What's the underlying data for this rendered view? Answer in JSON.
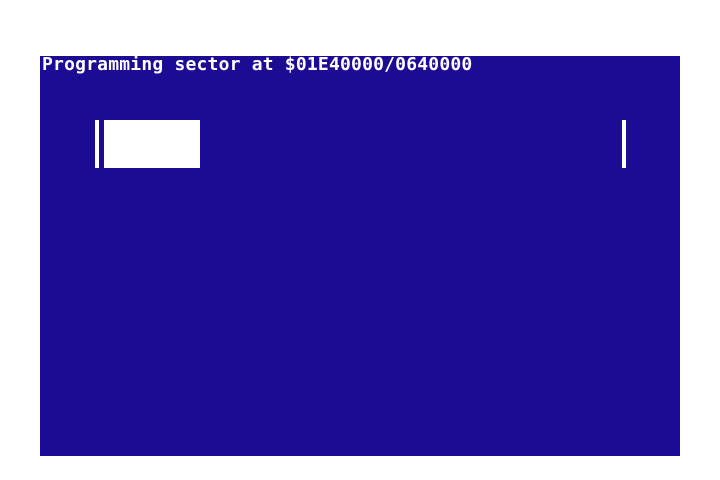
{
  "status": {
    "message": "Programming sector at $01E40000/0640000"
  },
  "progress": {
    "fraction": 0.186
  },
  "colors": {
    "screen_background": "#1c0c94",
    "foreground": "#ffffff",
    "border": "#ffffff"
  }
}
